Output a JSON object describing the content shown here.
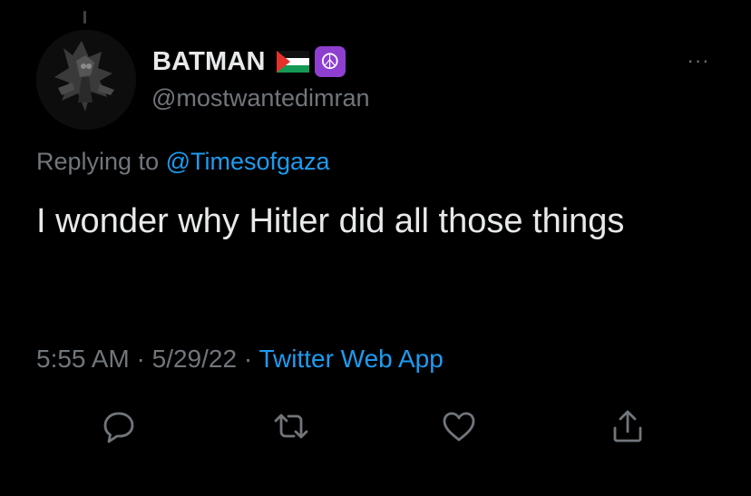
{
  "tweet": {
    "author": {
      "display_name": "BATMAN",
      "handle": "@mostwantedimran",
      "badges": [
        "palestine-flag",
        "peace-symbol"
      ],
      "peace_symbol": "☮"
    },
    "more_label": "···",
    "replying_prefix": "Replying to ",
    "replying_to": "@Timesofgaza",
    "text": "I wonder why Hitler did all those things",
    "time": "5:55 AM",
    "separator": " · ",
    "date": "5/29/22",
    "source": "Twitter Web App"
  },
  "actions": [
    {
      "name": "reply",
      "icon": "speech-bubble-icon"
    },
    {
      "name": "retweet",
      "icon": "retweet-icon"
    },
    {
      "name": "like",
      "icon": "heart-icon"
    },
    {
      "name": "share",
      "icon": "share-icon"
    }
  ],
  "colors": {
    "background": "#000000",
    "primary_text": "#e7e9ea",
    "secondary_text": "#71767b",
    "link": "#1d9bf0",
    "peace_badge": "#8f3fcf"
  }
}
